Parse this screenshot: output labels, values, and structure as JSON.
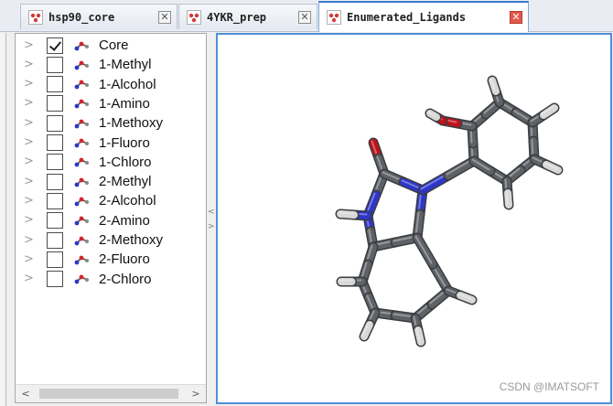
{
  "tabs": [
    {
      "label": "hsp90_core",
      "active": false
    },
    {
      "label": "4YKR_prep",
      "active": false
    },
    {
      "label": "Enumerated_Ligands",
      "active": true
    }
  ],
  "tree": {
    "items": [
      {
        "label": "Core",
        "checked": true
      },
      {
        "label": "1-Methyl",
        "checked": false
      },
      {
        "label": "1-Alcohol",
        "checked": false
      },
      {
        "label": "1-Amino",
        "checked": false
      },
      {
        "label": "1-Methoxy",
        "checked": false
      },
      {
        "label": "1-Fluoro",
        "checked": false
      },
      {
        "label": "1-Chloro",
        "checked": false
      },
      {
        "label": "2-Methyl",
        "checked": false
      },
      {
        "label": "2-Alcohol",
        "checked": false
      },
      {
        "label": "2-Amino",
        "checked": false
      },
      {
        "label": "2-Methoxy",
        "checked": false
      },
      {
        "label": "2-Fluoro",
        "checked": false
      },
      {
        "label": "2-Chloro",
        "checked": false
      }
    ],
    "expander_glyph": ">",
    "scroll_left": "<",
    "scroll_right": ">"
  },
  "splitter": {
    "up": "<",
    "down": ">"
  },
  "viewer": {
    "watermark": "CSDN @IMATSOFT",
    "colors": {
      "carbon": "#5e6266",
      "oxygen": "#c0121a",
      "nitrogen": "#2e36c8",
      "hydrogen": "#d8d8d8"
    }
  },
  "colors": {
    "accent": "#3b79c9",
    "close_active": "#e2574c"
  }
}
